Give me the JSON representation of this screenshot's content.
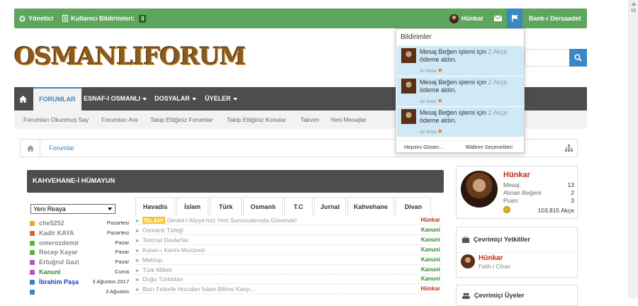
{
  "topbar": {
    "admin_label": "Yönetici",
    "reports_label": "Kullanıcı Bildirimleri:",
    "reports_count": "0",
    "username": "Hünkar",
    "bank_label": "Bank-ı Dersaadet"
  },
  "logo_text": "OSMANLIFORUM",
  "nav": {
    "tabs": [
      "FORUMLAR",
      "ESNAF-I OSMANLI",
      "DOSYALAR",
      "ÜYELER"
    ]
  },
  "subnav": [
    "Forumları Okunmuş Say",
    "Forumları Ara",
    "Takip Ettiğiniz Forumlar",
    "Takip Ettiğiniz Konular",
    "Takvim",
    "Yeni Mesajlar"
  ],
  "breadcrumb": "Forumlar",
  "section_title": "KAHVEHANE-İ HÜMAYUN",
  "reaya_select": "Yeni Reaya",
  "users": [
    {
      "name": "che5252",
      "date": "Pazartesi",
      "color": "#888888",
      "icon": "#f0a020"
    },
    {
      "name": "Kadir KAYA",
      "date": "Pazartesi",
      "color": "#888888",
      "icon": "#e06030"
    },
    {
      "name": "omerozdemir",
      "date": "Pazar",
      "color": "#888888",
      "icon": "#60b040"
    },
    {
      "name": "Recep Kayar",
      "date": "Pazar",
      "color": "#888888",
      "icon": "#60b040"
    },
    {
      "name": "Ertuğrul Gazi",
      "date": "Pazar",
      "color": "#888888",
      "icon": "#c050c0"
    },
    {
      "name": "Kanuni",
      "date": "Cuma",
      "color": "#2e8b2e",
      "icon": "#c050c0"
    },
    {
      "name": "İbrahim Paşa",
      "date": "3 Ağustos 2017",
      "color": "#2040c0",
      "icon": "#3a87c6"
    },
    {
      "name": "",
      "date": "3 Ağustos",
      "color": "#888888",
      "icon": "#3a87c6"
    }
  ],
  "tabs": [
    "Havadis",
    "İslam",
    "Türk",
    "Osmanlı",
    "T.C",
    "Jurnal",
    "Kahvehane",
    "Divan"
  ],
  "news": [
    {
      "tag": "ISLAH!",
      "title": "Devlet-i Aliyye'miz Yeni Sunucularında Güvende!",
      "author": "Hünkar",
      "author_color": "#c72c1c"
    },
    {
      "tag": "",
      "title": "Osmanlı Tüfeği",
      "author": "Kanuni",
      "author_color": "#2e8b2e"
    },
    {
      "tag": "",
      "title": "Terörist Devlet'ler",
      "author": "Kanuni",
      "author_color": "#2e8b2e"
    },
    {
      "tag": "",
      "title": "Kuran-ı Kerim Mucizesi",
      "author": "Kanuni",
      "author_color": "#2e8b2e"
    },
    {
      "tag": "",
      "title": "Mektup",
      "author": "Kanuni",
      "author_color": "#2e8b2e"
    },
    {
      "tag": "",
      "title": "Türk Milleti",
      "author": "Kanuni",
      "author_color": "#2e8b2e"
    },
    {
      "tag": "",
      "title": "Doğu Türkistan",
      "author": "Kanuni",
      "author_color": "#2e8b2e"
    },
    {
      "tag": "",
      "title": "Bazı Felsefe Hocaları İslam Bilime Karşı...",
      "author": "Hünkar",
      "author_color": "#c72c1c"
    }
  ],
  "profile": {
    "name": "Hünkar",
    "stats": [
      {
        "label": "Mesaj:",
        "value": "13"
      },
      {
        "label": "Alınan Beğeni:",
        "value": "2"
      },
      {
        "label": "Puan:",
        "value": "3"
      }
    ],
    "coins": "103,815 Akçe"
  },
  "online_staff": {
    "title": "Çevrimiçi Yetkililer",
    "name": "Hünkar",
    "sub": "Fatih-i Cihan"
  },
  "online_members_title": "Çevrimiçi Üyeler",
  "notifications": {
    "header": "Bildirimler",
    "items": [
      {
        "pre": "Mesaj Beğen işlemi için",
        "amount": "2 Akçe",
        "post": "ödeme aldın.",
        "ago": "Az önce"
      },
      {
        "pre": "Mesaj Beğen işlemi için",
        "amount": "2 Akçe",
        "post": "ödeme aldın.",
        "ago": "Az önce"
      },
      {
        "pre": "Mesaj Beğen işlemi için",
        "amount": "2 Akçe",
        "post": "ödeme aldın.",
        "ago": "Az önce"
      }
    ],
    "show_all": "Hepsini Göster...",
    "options": "Bildirim Seçenekleri"
  }
}
